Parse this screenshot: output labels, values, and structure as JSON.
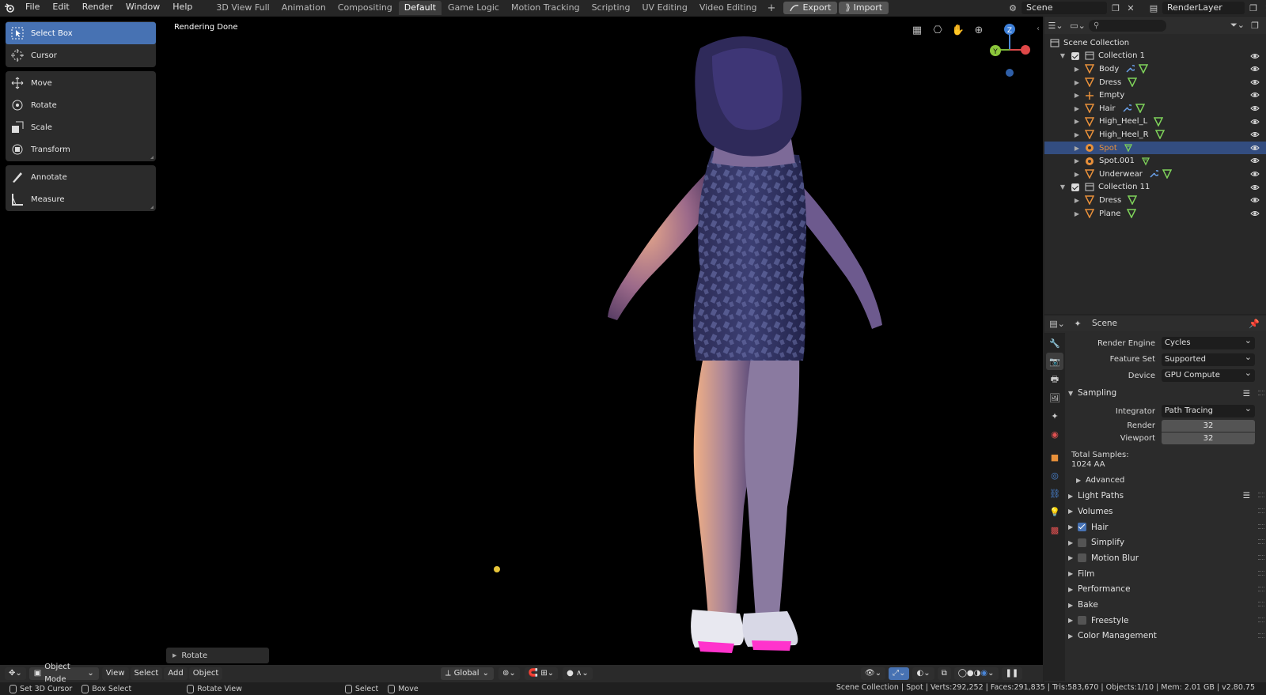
{
  "topbar": {
    "menus": [
      "File",
      "Edit",
      "Render",
      "Window",
      "Help"
    ],
    "workspaces": [
      "3D View Full",
      "Animation",
      "Compositing",
      "Default",
      "Game Logic",
      "Motion Tracking",
      "Scripting",
      "UV Editing",
      "Video Editing"
    ],
    "active_workspace": "Default",
    "export_label": "Export",
    "import_label": "Import",
    "scene_name": "Scene",
    "view_layer": "RenderLayer"
  },
  "viewport": {
    "status": "Rendering Done",
    "tools": {
      "select_box": "Select Box",
      "cursor": "Cursor",
      "move": "Move",
      "rotate": "Rotate",
      "scale": "Scale",
      "transform": "Transform",
      "annotate": "Annotate",
      "measure": "Measure"
    },
    "redo_panel": "Rotate",
    "gizmo": {
      "z": "Z",
      "y": "Y"
    }
  },
  "vp_header": {
    "mode": "Object Mode",
    "menus": [
      "View",
      "Select",
      "Add",
      "Object"
    ],
    "orientation": "Global"
  },
  "statusbar": {
    "set_cursor": "Set 3D Cursor",
    "box_select": "Box Select",
    "rotate_view": "Rotate View",
    "select": "Select",
    "move": "Move",
    "stats": "Scene Collection | Spot | Verts:292,252 | Faces:291,835 | Tris:583,670 | Objects:1/10 | Mem: 2.01 GB | v2.80.75"
  },
  "outliner": {
    "root": "Scene Collection",
    "collections": [
      {
        "name": "Collection 1",
        "items": [
          {
            "name": "Body",
            "type": "mesh",
            "mods": [
              "wrench",
              "mesh"
            ]
          },
          {
            "name": "Dress",
            "type": "mesh",
            "mods": [
              "mesh"
            ]
          },
          {
            "name": "Empty",
            "type": "empty",
            "mods": []
          },
          {
            "name": "Hair",
            "type": "mesh",
            "mods": [
              "wrench",
              "mesh"
            ]
          },
          {
            "name": "High_Heel_L",
            "type": "mesh",
            "mods": [
              "mesh"
            ]
          },
          {
            "name": "High_Heel_R",
            "type": "mesh",
            "mods": [
              "mesh"
            ]
          },
          {
            "name": "Spot",
            "type": "light",
            "mods": [
              "light"
            ],
            "selected": true
          },
          {
            "name": "Spot.001",
            "type": "light",
            "mods": [
              "light"
            ]
          },
          {
            "name": "Underwear",
            "type": "mesh",
            "mods": [
              "wrench",
              "mesh"
            ]
          }
        ]
      },
      {
        "name": "Collection 11",
        "items": [
          {
            "name": "Dress",
            "type": "mesh",
            "mods": [
              "mesh"
            ]
          },
          {
            "name": "Plane",
            "type": "mesh",
            "mods": [
              "mesh"
            ]
          }
        ]
      }
    ]
  },
  "properties": {
    "context": "Scene",
    "render_engine_label": "Render Engine",
    "render_engine": "Cycles",
    "feature_set_label": "Feature Set",
    "feature_set": "Supported",
    "device_label": "Device",
    "device": "GPU Compute",
    "sampling": "Sampling",
    "integrator_label": "Integrator",
    "integrator": "Path Tracing",
    "render_label": "Render",
    "render_samples": "32",
    "viewport_label": "Viewport",
    "viewport_samples": "32",
    "total_samples_label": "Total Samples:",
    "total_samples": "1024 AA",
    "advanced": "Advanced",
    "sections": [
      {
        "label": "Light Paths",
        "checkbox": null,
        "list": true
      },
      {
        "label": "Volumes",
        "checkbox": null
      },
      {
        "label": "Hair",
        "checkbox": true
      },
      {
        "label": "Simplify",
        "checkbox": false
      },
      {
        "label": "Motion Blur",
        "checkbox": false
      },
      {
        "label": "Film",
        "checkbox": null
      },
      {
        "label": "Performance",
        "checkbox": null
      },
      {
        "label": "Bake",
        "checkbox": null
      },
      {
        "label": "Freestyle",
        "checkbox": false
      },
      {
        "label": "Color Management",
        "checkbox": null
      }
    ]
  },
  "colors": {
    "accent": "#4772b3",
    "selection_row": "#334d80",
    "mesh_icon": "#7fd35a",
    "object_icon": "#e8903a"
  }
}
